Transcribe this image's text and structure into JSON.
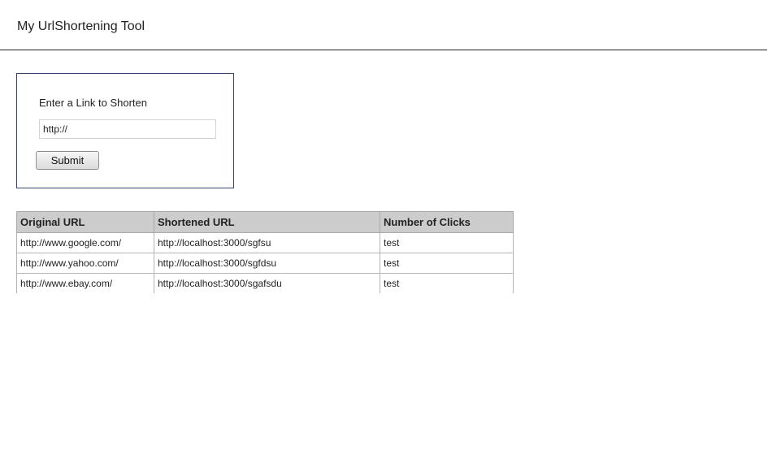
{
  "header": {
    "title": "My UrlShortening Tool"
  },
  "form": {
    "label": "Enter a Link to Shorten",
    "input_value": "http://",
    "submit_label": "Submit"
  },
  "table": {
    "columns": [
      "Original URL",
      "Shortened URL",
      "Number of Clicks"
    ],
    "rows": [
      [
        "http://www.google.com/",
        "http://localhost:3000/sgfsu",
        "test"
      ],
      [
        "http://www.yahoo.com/",
        "http://localhost:3000/sgfdsu",
        "test"
      ],
      [
        "http://www.ebay.com/",
        "http://localhost:3000/sgafsdu",
        "test"
      ]
    ]
  },
  "colors": {
    "header_rule": "#222222",
    "form_border": "#34466b",
    "table_header_bg": "#cccccc"
  }
}
